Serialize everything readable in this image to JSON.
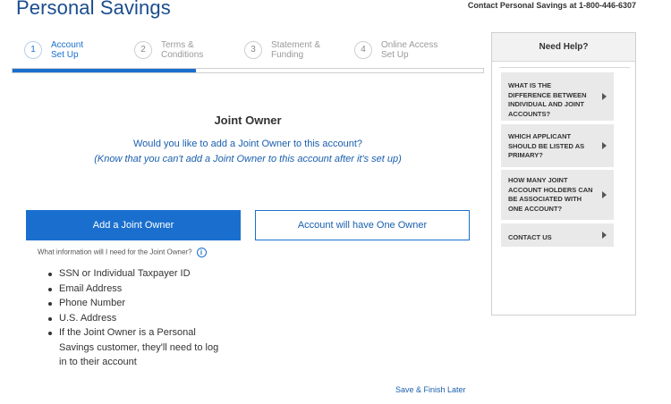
{
  "header": {
    "title": "Personal Savings",
    "contact": "Contact Personal Savings at 1-800-446-6307"
  },
  "stepper": {
    "steps": [
      {
        "number": "1",
        "label": "Account Set Up",
        "active": true
      },
      {
        "number": "2",
        "label": "Terms & Conditions",
        "active": false
      },
      {
        "number": "3",
        "label": "Statement & Funding",
        "active": false
      },
      {
        "number": "4",
        "label": "Online Access Set Up",
        "active": false
      }
    ],
    "progress_fraction": 0.39
  },
  "main": {
    "section_title": "Joint Owner",
    "question": "Would you like to add a Joint Owner to this account?",
    "note": "(Know that you can't add a Joint Owner to this account after it's set up)",
    "add_button": "Add a Joint Owner",
    "one_owner_button": "Account will have One Owner",
    "info_text": "What information will I need for the Joint Owner?",
    "info_icon": "i",
    "requirements": [
      "SSN or Individual Taxpayer ID",
      "Email Address",
      "Phone Number",
      "U.S. Address",
      "If the Joint Owner is a Personal Savings customer, they'll need to log in to their account"
    ],
    "save_link": "Save & Finish Later"
  },
  "help": {
    "title": "Need Help?",
    "items": [
      "What is the difference between individual and joint accounts?",
      "Which applicant should be listed as primary?",
      "How many joint account holders can be associated with one account?",
      "Contact Us"
    ]
  },
  "colors": {
    "accent": "#1a6fce",
    "brand": "#1a4d8f",
    "link": "#1a5fae"
  }
}
